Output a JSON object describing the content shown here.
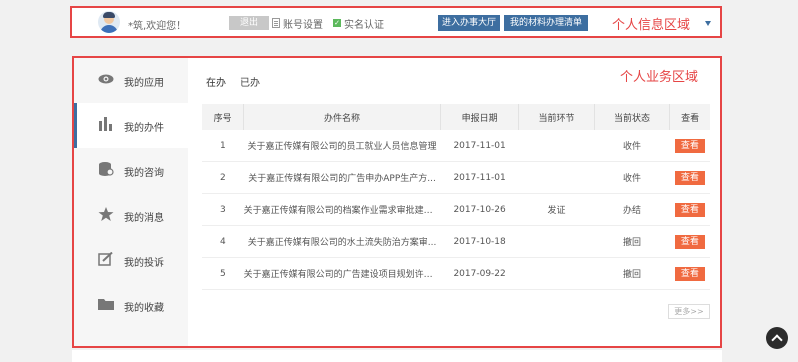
{
  "topbar": {
    "welcome": "*筑,欢迎您！",
    "logout_label": "退出",
    "account_settings": "账号设置",
    "cert_label": "实名认证",
    "enter_hall_label": "进入办事大厅",
    "my_docs_label": "我的材料办理清单",
    "region_label": "个人信息区域"
  },
  "sidebar": {
    "items": [
      {
        "label": "我的应用",
        "icon": "eye-icon"
      },
      {
        "label": "我的办件",
        "icon": "bar-chart-icon"
      },
      {
        "label": "我的咨询",
        "icon": "consult-icon"
      },
      {
        "label": "我的消息",
        "icon": "star-icon"
      },
      {
        "label": "我的投诉",
        "icon": "complaint-icon"
      },
      {
        "label": "我的收藏",
        "icon": "folder-icon"
      }
    ]
  },
  "main": {
    "tabs": [
      "在办",
      "已办"
    ],
    "region_label": "个人业务区域",
    "columns": [
      "序号",
      "办件名称",
      "申报日期",
      "当前环节",
      "当前状态",
      "查看"
    ],
    "rows": [
      {
        "no": "1",
        "name": "关于嘉正传媒有限公司的员工就业人员信息管理",
        "date": "2017-11-01",
        "step": "",
        "status": "收件",
        "view": "查看"
      },
      {
        "no": "2",
        "name": "关于嘉正传媒有限公司的广告申办APP生产方...",
        "date": "2017-11-01",
        "step": "",
        "status": "收件",
        "view": "查看"
      },
      {
        "no": "3",
        "name": "关于嘉正传媒有限公司的档案作业需求审批建设...",
        "date": "2017-10-26",
        "step": "发证",
        "status": "办结",
        "view": "查看"
      },
      {
        "no": "4",
        "name": "关于嘉正传媒有限公司的水土流失防治方案审...",
        "date": "2017-10-18",
        "step": "",
        "status": "撤回",
        "view": "查看"
      },
      {
        "no": "5",
        "name": "关于嘉正传媒有限公司的广告建设项目规划许可...",
        "date": "2017-09-22",
        "step": "",
        "status": "撤回",
        "view": "查看"
      }
    ],
    "pager_label": "更多>>"
  },
  "colors": {
    "accent": "#3d6ea0",
    "annotation_red": "#e64545",
    "view_button": "#f06a40"
  }
}
